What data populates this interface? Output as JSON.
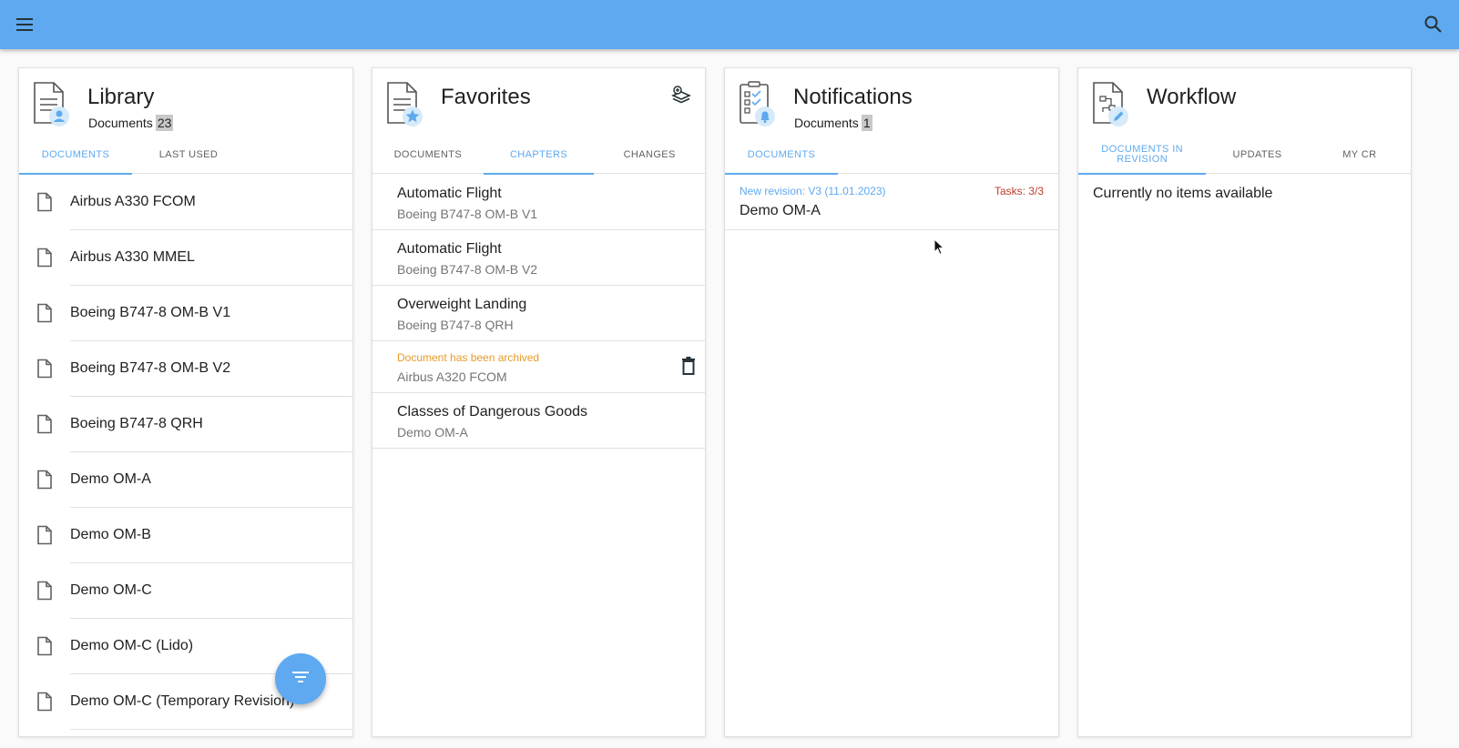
{
  "colors": {
    "primary": "#5ea9f0",
    "warning": "#e69a28",
    "danger": "#c0392b",
    "muted": "#757575"
  },
  "topbar": {
    "menu_icon": "menu-icon",
    "search_icon": "search-icon"
  },
  "library": {
    "title": "Library",
    "subtitle": "Documents",
    "count": "23",
    "tabs": [
      "Documents",
      "Last used"
    ],
    "active_tab": 0,
    "items": [
      "Airbus A330 FCOM",
      "Airbus A330 MMEL",
      "Boeing B747-8 OM-B V1",
      "Boeing B747-8 OM-B V2",
      "Boeing B747-8 QRH",
      "Demo OM-A",
      "Demo OM-B",
      "Demo OM-C",
      "Demo OM-C (Lido)",
      "Demo OM-C (Temporary Revision)"
    ]
  },
  "favorites": {
    "title": "Favorites",
    "tabs": [
      "Documents",
      "Chapters",
      "Changes"
    ],
    "active_tab": 1,
    "items": [
      {
        "primary": "Automatic Flight",
        "secondary": "Boeing B747-8 OM-B V1"
      },
      {
        "primary": "Automatic Flight",
        "secondary": "Boeing B747-8 OM-B V2"
      },
      {
        "primary": "Overweight Landing",
        "secondary": "Boeing B747-8 QRH"
      },
      {
        "warning": "Document has been archived",
        "secondary": "Airbus A320 FCOM",
        "archived": true
      },
      {
        "primary": "Classes of Dangerous Goods",
        "secondary": "Demo OM-A"
      }
    ]
  },
  "notifications": {
    "title": "Notifications",
    "subtitle": "Documents",
    "count": "1",
    "tabs": [
      "Documents"
    ],
    "active_tab": 0,
    "items": [
      {
        "revision": "New revision: V3 (11.01.2023)",
        "tasks": "Tasks: 3/3",
        "name": "Demo OM-A"
      }
    ]
  },
  "workflow": {
    "title": "Workflow",
    "tabs": [
      "Documents in revision",
      "Updates",
      "My CR"
    ],
    "active_tab": 0,
    "empty_text": "Currently no items available"
  }
}
